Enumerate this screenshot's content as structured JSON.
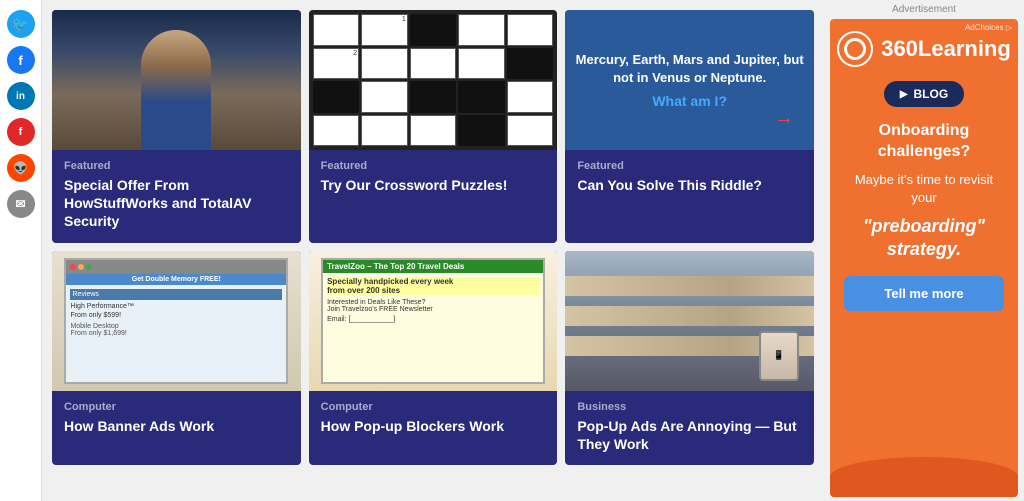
{
  "social": {
    "icons": [
      {
        "name": "twitter",
        "symbol": "🐦",
        "class": "social-twitter"
      },
      {
        "name": "facebook",
        "symbol": "f",
        "class": "social-facebook"
      },
      {
        "name": "linkedin",
        "symbol": "in",
        "class": "social-linkedin"
      },
      {
        "name": "flipboard",
        "symbol": "f",
        "class": "social-flipboard"
      },
      {
        "name": "reddit",
        "symbol": "👽",
        "class": "social-reddit"
      },
      {
        "name": "email",
        "symbol": "✉",
        "class": "social-email"
      }
    ]
  },
  "cards": [
    {
      "category": "Featured",
      "title": "Special Offer From HowStuffWorks and TotalAV Security",
      "image_type": "person"
    },
    {
      "category": "Featured",
      "title": "Try Our Crossword Puzzles!",
      "image_type": "crossword"
    },
    {
      "category": "Featured",
      "title": "Can You Solve This Riddle?",
      "image_type": "riddle"
    },
    {
      "category": "Computer",
      "title": "How Banner Ads Work",
      "image_type": "banner-ad"
    },
    {
      "category": "Computer",
      "title": "How Pop-up Blockers Work",
      "image_type": "popup"
    },
    {
      "category": "Business",
      "title": "Pop-Up Ads Are Annoying — But They Work",
      "image_type": "store"
    }
  ],
  "riddle": {
    "text": "Mercury, Earth, Mars and Jupiter, but not in Venus or Neptune.",
    "answer": "What am I?",
    "arrow": "→"
  },
  "ad": {
    "label": "Advertisement",
    "ad_choices": "AdChoices ▷",
    "brand": "360Learning",
    "blog_label": "BLOG",
    "headline": "Onboarding challenges?",
    "subtext": "Maybe it's time to revisit your",
    "quote": "\"preboarding\" strategy.",
    "cta": "Tell me more"
  },
  "crossword_numbers": {
    "cell_1_2": "1",
    "cell_2_1": "2"
  }
}
